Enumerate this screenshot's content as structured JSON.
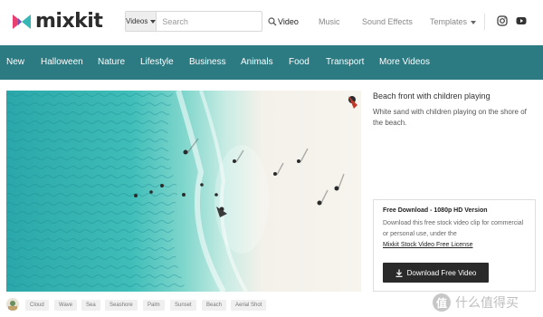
{
  "brand": {
    "name": "mixkit"
  },
  "search": {
    "scope": "Videos",
    "placeholder": "Search"
  },
  "topnav": {
    "video": "Video",
    "music": "Music",
    "sound_effects": "Sound Effects",
    "templates": "Templates"
  },
  "categories": [
    "New",
    "Halloween",
    "Nature",
    "Lifestyle",
    "Business",
    "Animals",
    "Food",
    "Transport",
    "More Videos"
  ],
  "video": {
    "title": "Beach front with children playing",
    "description": "White sand with children playing on the shore of the beach."
  },
  "download": {
    "heading": "Free Download - 1080p HD Version",
    "text": "Download this free stock video clip for commercial or personal use, under the",
    "license_link": "Mixkit Stock Video Free License",
    "button": "Download Free Video"
  },
  "tags": [
    "Cloud",
    "Wave",
    "Sea",
    "Seashore",
    "Palm",
    "Sunset",
    "Beach",
    "Aerial Shot"
  ],
  "watermark": {
    "text": "什么值得买",
    "badge": "值"
  },
  "colors": {
    "category_bar": "#2c7a82",
    "download_button": "#2a2a2a",
    "logo_pink": "#e8416f",
    "logo_teal": "#35b7b5"
  }
}
